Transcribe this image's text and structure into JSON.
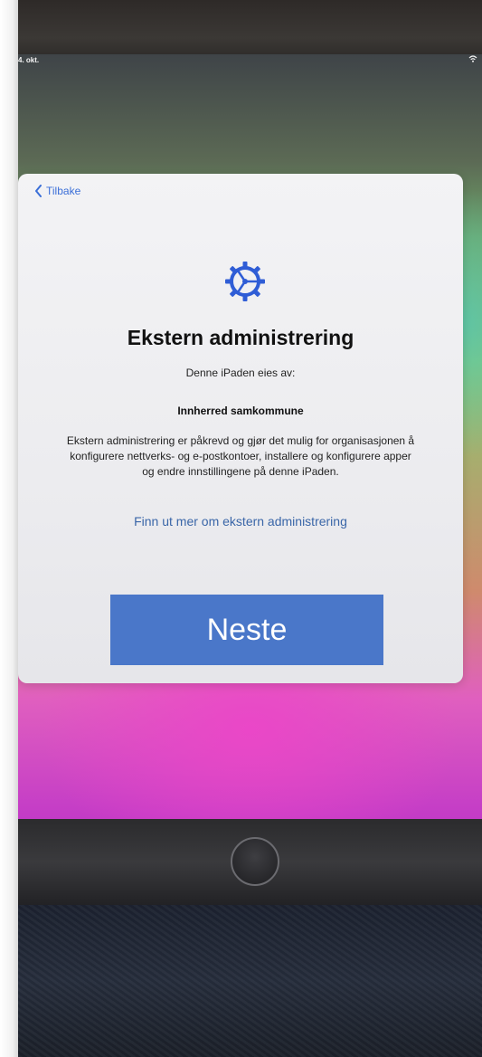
{
  "status_bar": {
    "date": "4. okt.",
    "icons": [
      "wifi-icon"
    ]
  },
  "dialog": {
    "back_label": "Tilbake",
    "icon": "gear-icon",
    "title": "Ekstern administrering",
    "owner_label": "Denne iPaden eies av:",
    "owner_name": "Innherred samkommune",
    "description": "Ekstern administrering er påkrevd og gjør det mulig for organisasjonen å konfigurere nettverks- og e-postkontoer, installere og konfigurere apper og endre innstillingene på denne iPaden.",
    "learn_more_link": "Finn ut mer om ekstern administrering",
    "next_button": "Neste"
  },
  "colors": {
    "accent": "#3b6fd8",
    "next_button_bg": "#4a77c9",
    "card_bg": "#f0f0f2"
  }
}
